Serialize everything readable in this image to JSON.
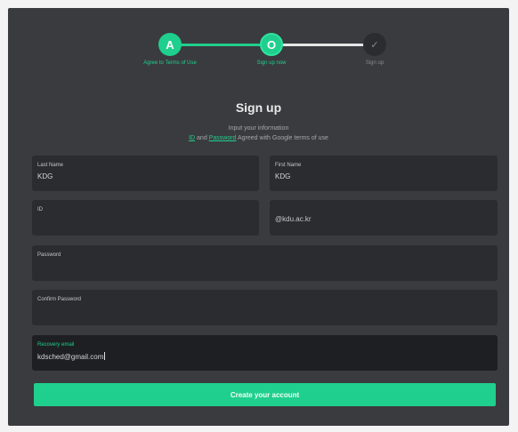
{
  "stepper": {
    "steps": [
      {
        "icon_text": "A",
        "label": "Agree to Terms of Use",
        "state": "done"
      },
      {
        "icon_text": "O",
        "label": "Sign up now",
        "state": "current"
      },
      {
        "icon_text": "✓",
        "label": "Sign up",
        "state": "pending"
      }
    ]
  },
  "header": {
    "title": "Sign up",
    "subtitle": "Input your information",
    "agreement_id": "ID",
    "agreement_and": "and",
    "agreement_password": "Password",
    "agreement_rest": "Agreed with Google terms of use"
  },
  "form": {
    "last_name": {
      "label": "Last Name",
      "value": "KDG"
    },
    "first_name": {
      "label": "First Name",
      "value": "KDG"
    },
    "id": {
      "label": "ID",
      "value": ""
    },
    "domain": {
      "value": "@kdu.ac.kr"
    },
    "password": {
      "label": "Password",
      "value": ""
    },
    "confirm_password": {
      "label": "Confirm Password",
      "value": ""
    },
    "recovery_email": {
      "label": "Recovery email",
      "value": "kdsched@gmail.com"
    }
  },
  "submit": {
    "label": "Create your account"
  },
  "colors": {
    "accent": "#1fcf8d",
    "panel": "#3a3b3e",
    "field": "#2b2c2f"
  }
}
